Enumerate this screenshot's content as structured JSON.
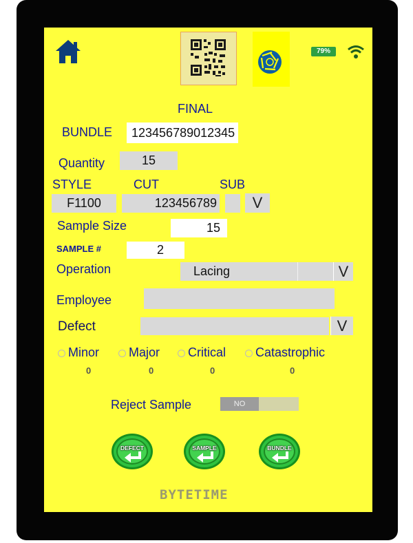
{
  "status": {
    "battery_percent": "79%",
    "battery_color": "#2ea043"
  },
  "title": "FINAL",
  "bundle": {
    "label": "BUNDLE",
    "value": "123456789012345"
  },
  "quantity": {
    "label": "Quantity",
    "value": "15"
  },
  "style": {
    "label": "STYLE",
    "value": "F1100"
  },
  "cut": {
    "label": "CUT",
    "value": "123456789"
  },
  "sub": {
    "label": "SUB",
    "value": "",
    "dropdown_glyph": "V"
  },
  "sample_size": {
    "label": "Sample Size",
    "value": "15"
  },
  "sample_number": {
    "label": "SAMPLE #",
    "value": "2"
  },
  "operation": {
    "label": "Operation",
    "value": "Lacing",
    "dropdown_glyph": "V"
  },
  "employee": {
    "label": "Employee",
    "value": ""
  },
  "defect": {
    "label": "Defect",
    "value": "",
    "dropdown_glyph": "V"
  },
  "severity": [
    {
      "label": "Minor",
      "count": "0"
    },
    {
      "label": "Major",
      "count": "0"
    },
    {
      "label": "Critical",
      "count": "0"
    },
    {
      "label": "Catastrophic",
      "count": "0"
    }
  ],
  "reject_sample": {
    "label": "Reject Sample",
    "toggle_state": "NO"
  },
  "actions": {
    "defect": "DEFECT",
    "sample": "SAMPLE",
    "bundle": "BUNDLE"
  },
  "brand": "BYTETIME",
  "colors": {
    "background": "#ffff3c",
    "label_text": "#10189a",
    "field": "#d9d9d9",
    "action_green": "#2fc13f"
  },
  "icons": [
    "home-icon",
    "qr-code-icon",
    "camera-shutter-icon",
    "battery-icon",
    "wifi-icon"
  ]
}
